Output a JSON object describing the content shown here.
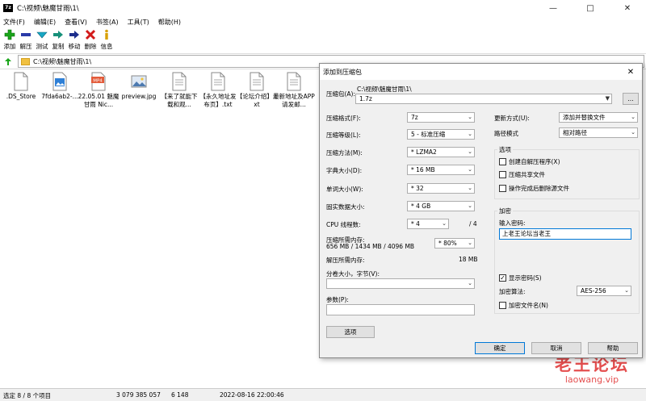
{
  "window": {
    "title": "C:\\视频\\魅魔甘雨\\1\\",
    "icon_label": "7z"
  },
  "menu": [
    "文件(F)",
    "编辑(E)",
    "查看(V)",
    "书签(A)",
    "工具(T)",
    "帮助(H)"
  ],
  "toolbar": [
    {
      "label": "添加",
      "icon": "add-icon"
    },
    {
      "label": "解压",
      "icon": "extract-icon"
    },
    {
      "label": "测试",
      "icon": "test-icon"
    },
    {
      "label": "复制",
      "icon": "copy-icon"
    },
    {
      "label": "移动",
      "icon": "move-icon"
    },
    {
      "label": "删除",
      "icon": "delete-icon"
    },
    {
      "label": "信息",
      "icon": "info-icon"
    }
  ],
  "address": "C:\\视频\\魅魔甘雨\\1\\",
  "files": [
    {
      "name": ".DS_Store",
      "type": "doc"
    },
    {
      "name": "7fda6ab2-...",
      "type": "img"
    },
    {
      "name": "22.05.01 魅魔甘雨 Nic...",
      "type": "mp4"
    },
    {
      "name": "preview.jpg",
      "type": "photo"
    },
    {
      "name": "【来了就能下载和观...",
      "type": "doc"
    },
    {
      "name": "【永久地址发布页】.txt",
      "type": "doc"
    },
    {
      "name": "【论坛介绍】.txt",
      "type": "doc"
    },
    {
      "name": "最新地址及APP请发邮...",
      "type": "doc"
    }
  ],
  "status": {
    "selected": "选定 8 / 8 个项目",
    "size": "3 079 385 057",
    "packed": "6 148",
    "date": "2022-08-16 22:00:46"
  },
  "watermark": {
    "line1": "老王论坛",
    "line2": "laowang.vip"
  },
  "dialog": {
    "title": "添加到压缩包",
    "archive_label": "压缩包(A):",
    "archive_path": "C:\\视频\\魅魔甘雨\\1\\",
    "archive_name": "1.7z",
    "browse": "...",
    "format_label": "压缩格式(F):",
    "format": "7z",
    "level_label": "压缩等级(L):",
    "level": "5 - 标准压缩",
    "method_label": "压缩方法(M):",
    "method": "* LZMA2",
    "dict_label": "字典大小(D):",
    "dict": "* 16 MB",
    "word_label": "单词大小(W):",
    "word": "* 32",
    "solid_label": "固实数据大小:",
    "solid": "* 4 GB",
    "cpu_label": "CPU 线程数:",
    "cpu": "* 4",
    "cpu_max": "/ 4",
    "mem_label": "压缩所需内存:",
    "mem_values": "656 MB / 1434 MB / 4096 MB",
    "mem_pct": "* 80%",
    "dmem_label": "解压所需内存:",
    "dmem": "18 MB",
    "split_label": "分卷大小，字节(V):",
    "params_label": "参数(P):",
    "options_btn": "选项",
    "update_label": "更新方式(U):",
    "update": "添加并替换文件",
    "path_label": "路径模式",
    "path": "相对路径",
    "opts_group": "选项",
    "opt_sfx": "创建自解压程序(X)",
    "opt_shared": "压缩共享文件",
    "opt_delete": "操作完成后删除源文件",
    "enc_group": "加密",
    "pwd_label": "输入密码:",
    "pwd": "上老王论坛当老王",
    "show_pwd": "显示密码(S)",
    "enc_method_label": "加密算法:",
    "enc_method": "AES-256",
    "enc_names": "加密文件名(N)",
    "ok": "确定",
    "cancel": "取消",
    "help": "帮助"
  }
}
